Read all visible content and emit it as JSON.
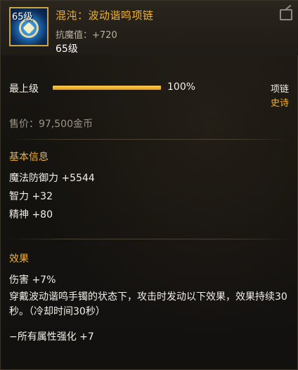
{
  "item": {
    "level_badge": "65级",
    "name": "混沌：波动谐鸣项链",
    "stat_label": "抗魔值：",
    "stat_value": "+720",
    "level_text": "65级",
    "icon": "necklace-icon",
    "share_icon": "share-icon"
  },
  "upgrade": {
    "label": "最上级",
    "percent_text": "100%",
    "progress": 1.0
  },
  "slot": "项链",
  "rarity": "史诗",
  "price": "售价：97,500金币",
  "basic_info": {
    "title": "基本信息",
    "stats": [
      "魔法防御力 +5544",
      "智力 +32",
      "精神 +80"
    ]
  },
  "effects": {
    "title": "效果",
    "lines": [
      "伤害 +7%",
      "穿戴波动谐鸣手镯的状态下，攻击时发动以下效果，效果持续30秒。（冷却时间30秒）",
      "−所有属性强化 +7"
    ]
  },
  "colors": {
    "gold": "#f0b232",
    "text": "#f2efe8",
    "muted": "#9c958a",
    "background": "#15130f"
  }
}
